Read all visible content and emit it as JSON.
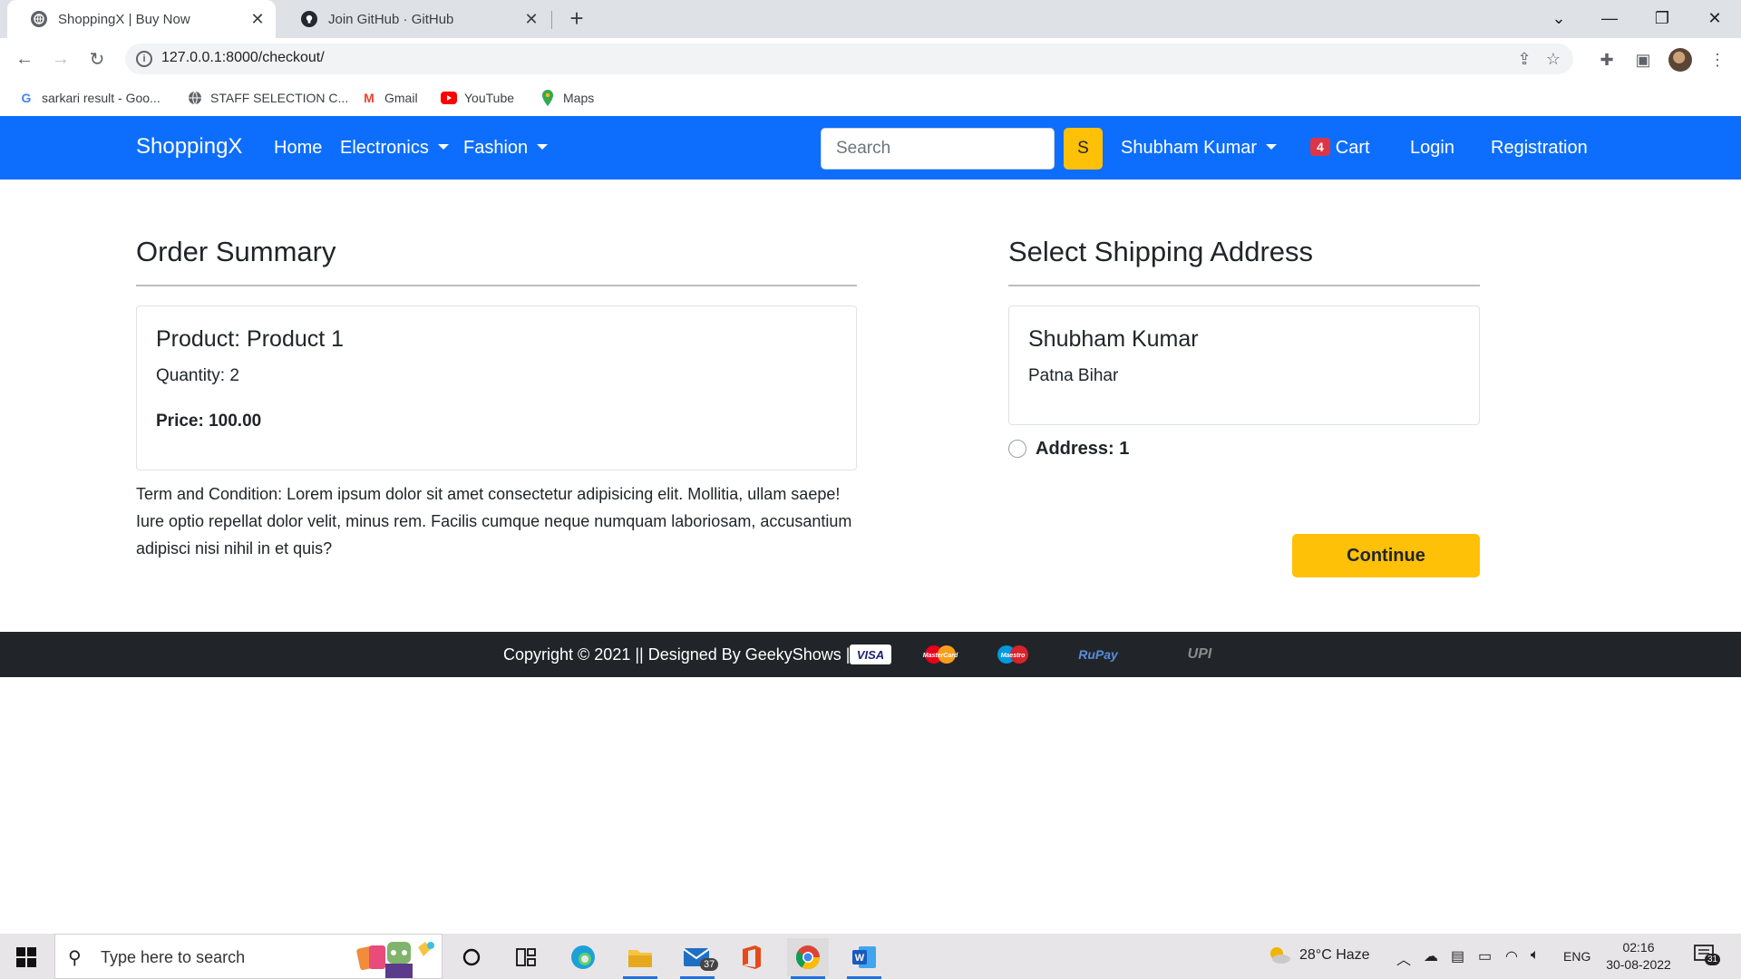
{
  "browser": {
    "tabs": [
      {
        "title": "ShoppingX | Buy Now",
        "active": true,
        "icon": "globe-icon"
      },
      {
        "title": "Join GitHub · GitHub",
        "active": false,
        "icon": "github-icon"
      }
    ],
    "url": "127.0.0.1:8000/checkout/",
    "bookmarks": [
      {
        "label": "sarkari result - Goo...",
        "icon": "google-icon"
      },
      {
        "label": "STAFF SELECTION C...",
        "icon": "globe-icon"
      },
      {
        "label": "Gmail",
        "icon": "gmail-icon"
      },
      {
        "label": "YouTube",
        "icon": "youtube-icon"
      },
      {
        "label": "Maps",
        "icon": "maps-icon"
      }
    ]
  },
  "navbar": {
    "brand": "ShoppingX",
    "home": "Home",
    "electronics": "Electronics",
    "fashion": "Fashion",
    "search_placeholder": "Search",
    "search_button": "S",
    "user": "Shubham Kumar",
    "cart_count": "4",
    "cart": "Cart",
    "login": "Login",
    "registration": "Registration"
  },
  "order_summary": {
    "heading": "Order Summary",
    "product": "Product: Product 1",
    "quantity": "Quantity: 2",
    "price": "Price: 100.00",
    "terms": "Term and Condition: Lorem ipsum dolor sit amet consectetur adipisicing elit. Mollitia, ullam saepe! Iure optio repellat dolor velit, minus rem. Facilis cumque neque numquam laboriosam, accusantium adipisci nisi nihil in et quis?"
  },
  "shipping": {
    "heading": "Select Shipping Address",
    "name": "Shubham Kumar",
    "address": "Patna Bihar",
    "radio_label": "Address: 1",
    "continue": "Continue"
  },
  "footer": {
    "copyright": "Copyright © 2021 || Designed By GeekyShows ||",
    "payments": [
      "VISA",
      "MasterCard",
      "Maestro",
      "RuPay",
      "UPI"
    ]
  },
  "taskbar": {
    "search_placeholder": "Type here to search",
    "mail_badge": "37",
    "weather": "28°C  Haze",
    "language": "ENG",
    "time": "02:16",
    "date": "30-08-2022",
    "notification_count": "31"
  },
  "colors": {
    "primary": "#0d6efd",
    "warning": "#ffc107",
    "danger": "#dc3545",
    "dark": "#212529"
  }
}
